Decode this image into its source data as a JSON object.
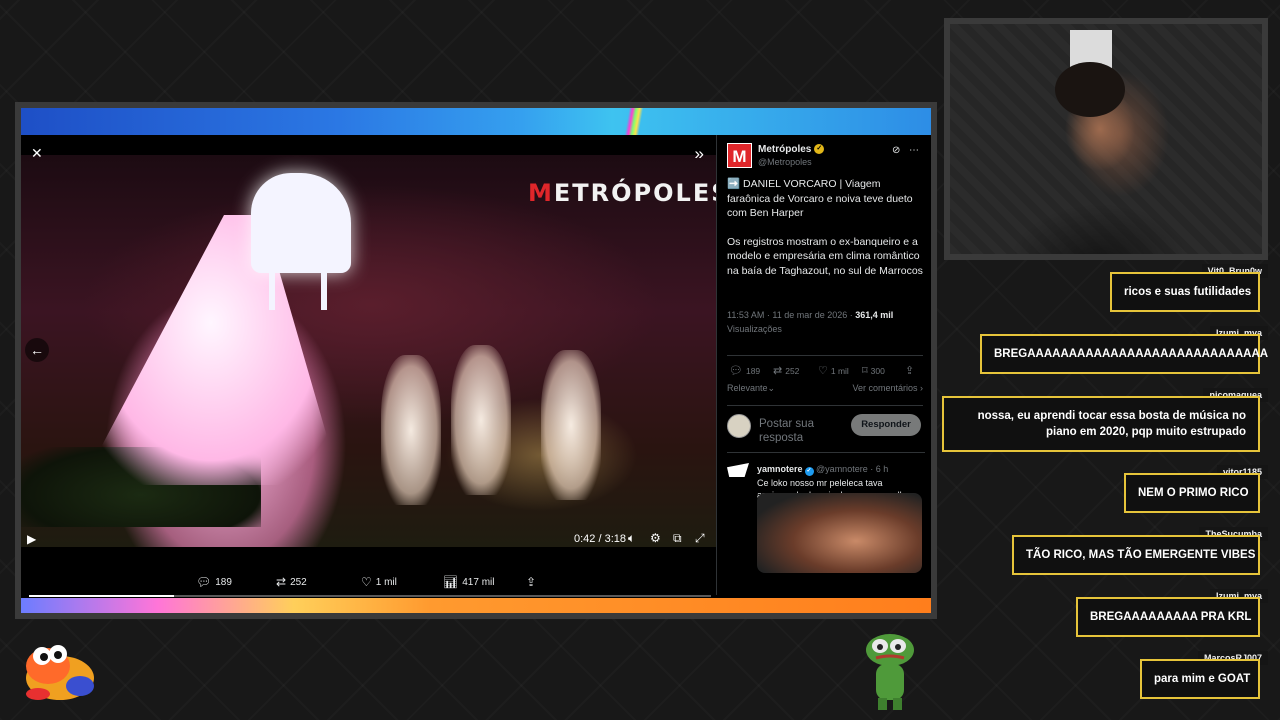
{
  "video": {
    "logo_mark": "M",
    "logo_text": "ETRÓPOLES",
    "current_time": "0:42",
    "duration": "3:18",
    "time_separator": " / ",
    "progress_fraction": 0.213,
    "engagement": {
      "replies": "189",
      "reposts": "252",
      "likes": "1 mil",
      "views": "417 mil"
    }
  },
  "tweet": {
    "avatar_letter": "M",
    "author": "Metrópoles",
    "handle": "@Metropoles",
    "text_1": "➡️ DANIEL VORCARO | Viagem faraônica de Vorcaro e noiva teve dueto com Ben Harper",
    "text_2": "Os registros mostram o ex-banqueiro e a modelo e empresária em clima romântico na baía de Taghazout, no sul de Marrocos",
    "timestamp": "11:53 AM · 11 de mar de 2026 · ",
    "views_count": "361,4 mil",
    "views_label": "Visualizações",
    "actions": {
      "replies": "189",
      "reposts": "252",
      "likes": "1 mil",
      "bookmarks": "300"
    },
    "sort_label": "Relevante",
    "see_comments": "Ver comentários",
    "reply_placeholder": "Postar sua resposta",
    "reply_button": "Responder"
  },
  "comment": {
    "name": "yamnotere",
    "handle": "@yamnotere · 6 h",
    "text": "Ce loko nosso mr peleleca tava apaixonado demais da pra ver os olhos brilhando daqui"
  },
  "chat": [
    {
      "user": "Vit0_Brun0w",
      "message": "ricos e suas futilidades"
    },
    {
      "user": "Izumi_mya",
      "message": "BREGAAAAAAAAAAAAAAAAAAAAAAAAAAAAA"
    },
    {
      "user": "nicomaquea",
      "message": "nossa, eu aprendi tocar essa bosta de música no piano em 2020, pqp muito estrupado"
    },
    {
      "user": "vitor1185",
      "message": "NEM O PRIMO RICO"
    },
    {
      "user": "TheSucumba",
      "message": "TÃO RICO, MAS TÃO EMERGENTE VIBES"
    },
    {
      "user": "Izumi_mya",
      "message": "BREGAAAAAAAAA PRA KRL"
    },
    {
      "user": "MarcosRJ007",
      "message": "para mim e GOAT"
    }
  ],
  "colors": {
    "chat_border": "#e6c43a",
    "metropoles_red": "#e0262a",
    "x_text": "#e7e9ea",
    "x_muted": "#71767b"
  }
}
